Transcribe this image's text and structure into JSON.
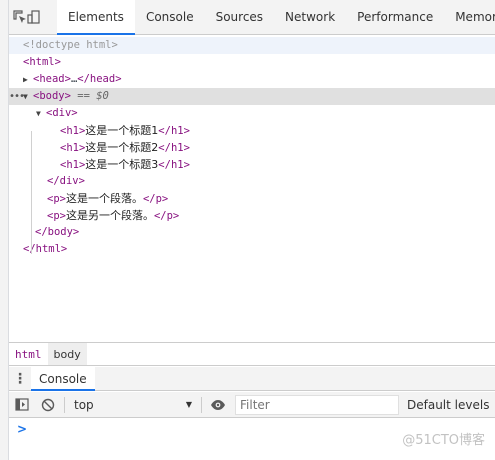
{
  "toolbar": {
    "tabs": [
      {
        "label": "Elements"
      },
      {
        "label": "Console"
      },
      {
        "label": "Sources"
      },
      {
        "label": "Network"
      },
      {
        "label": "Performance"
      },
      {
        "label": "Memory"
      }
    ],
    "icons": [
      "inspect-element-icon",
      "device-toolbar-icon"
    ]
  },
  "elements": {
    "doctype": "<!doctype html>",
    "html_open": "<html>",
    "head": {
      "open": "<head>",
      "ellipsis": "…",
      "close": "</head>"
    },
    "body_open": "<body>",
    "body_marker": "== $0",
    "div_open": "<div>",
    "h1_open": "<h1>",
    "h1_close": "</h1>",
    "headings": [
      "这是一个标题1",
      "这是一个标题2",
      "这是一个标题3"
    ],
    "div_close": "</div>",
    "p_open": "<p>",
    "p_close": "</p>",
    "paragraphs": [
      "这是一个段落。",
      "这是另一个段落。"
    ],
    "body_close": "</body>",
    "html_close": "</html>",
    "dots": "•••"
  },
  "breadcrumb": {
    "items": [
      "html",
      "body"
    ]
  },
  "drawer": {
    "tab_label": "Console"
  },
  "console": {
    "context": "top",
    "filter_placeholder": "Filter",
    "levels": "Default levels",
    "prompt": ">"
  },
  "watermark": "@51CTO博客",
  "colors": {
    "accent": "#1a73e8",
    "tag": "#881280",
    "panel_bg": "#f3f3f3"
  }
}
